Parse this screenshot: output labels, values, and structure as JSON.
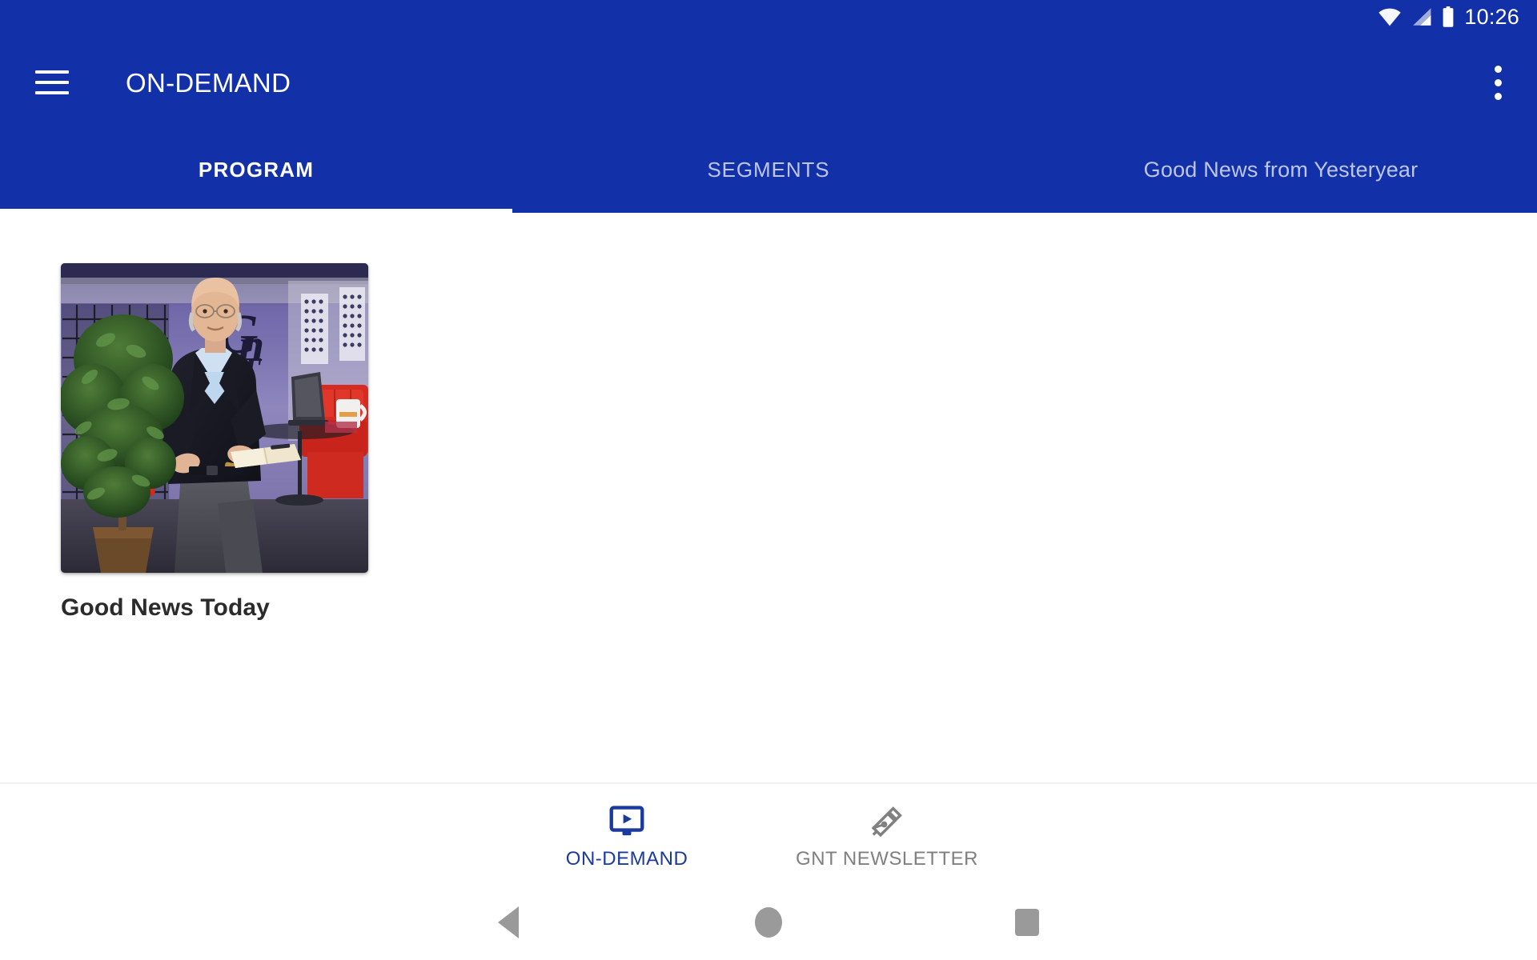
{
  "status_bar": {
    "time": "10:26",
    "icons": [
      "wifi-icon",
      "cell-signal-icon",
      "battery-icon"
    ],
    "background_color": "#1230a8"
  },
  "app_bar": {
    "menu_icon": "hamburger-menu-icon",
    "title": "ON-DEMAND",
    "overflow_icon": "more-vertical-icon",
    "background_color": "#1230a8",
    "text_color": "#ffffff"
  },
  "tabs": {
    "active_index": 0,
    "indicator_color": "#ffffff",
    "items": [
      {
        "label": "PROGRAM",
        "active": true
      },
      {
        "label": "SEGMENTS",
        "active": false
      },
      {
        "label": "Good News from Yesteryear",
        "active": false
      }
    ]
  },
  "main": {
    "cards": [
      {
        "title": "Good News Today",
        "thumbnail_alt": "studio-set-host-seated-at-table"
      }
    ]
  },
  "bottom_nav": {
    "active_index": 0,
    "active_color": "#1a3a9e",
    "inactive_color": "#808080",
    "items": [
      {
        "label": "ON-DEMAND",
        "icon": "tv-play-icon",
        "active": true
      },
      {
        "label": "GNT NEWSLETTER",
        "icon": "pen-nib-icon",
        "active": false
      }
    ]
  },
  "system_nav": {
    "buttons": [
      {
        "name": "back-button",
        "icon": "triangle-back-icon"
      },
      {
        "name": "home-button",
        "icon": "circle-home-icon"
      },
      {
        "name": "recents-button",
        "icon": "square-recents-icon"
      }
    ],
    "color": "#9a9a9a"
  }
}
